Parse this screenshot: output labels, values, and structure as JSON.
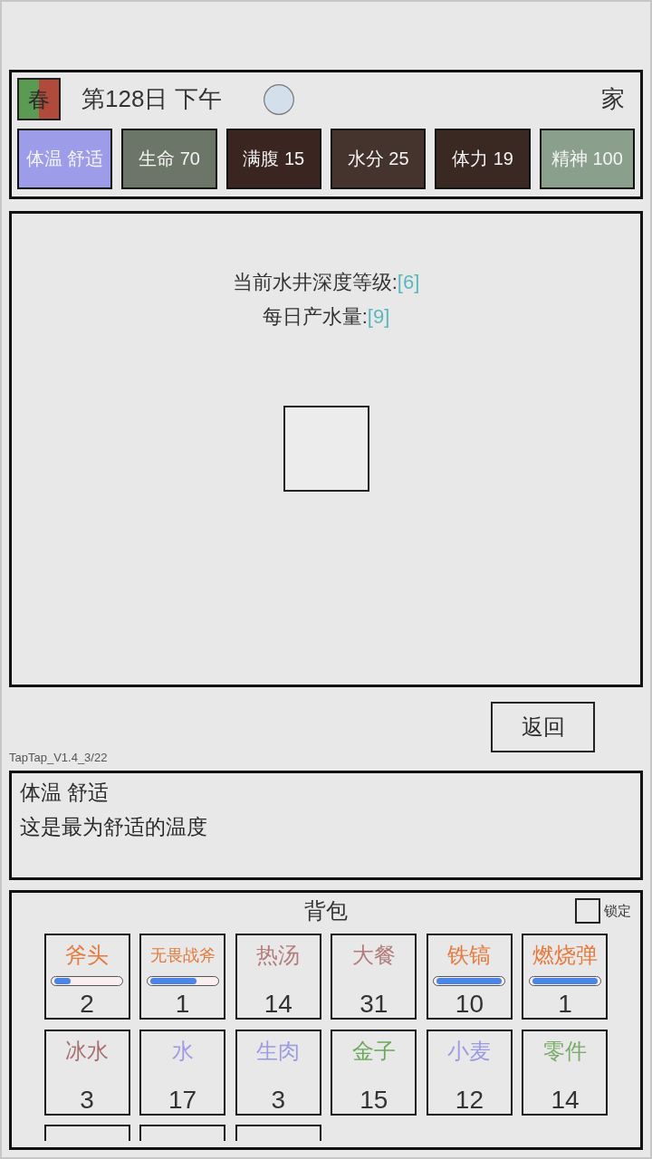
{
  "header": {
    "season": "春",
    "date": "第128日 下午",
    "location": "家"
  },
  "stats": [
    {
      "label": "体温 舒适",
      "color": "#9c9ce8"
    },
    {
      "label": "生命 70",
      "color": "#6c7668"
    },
    {
      "label": "满腹 15",
      "color": "#3a2520"
    },
    {
      "label": "水分 25",
      "color": "#45332d"
    },
    {
      "label": "体力 19",
      "color": "#3a2822"
    },
    {
      "label": "精神 100",
      "color": "#8aa08d"
    }
  ],
  "well": {
    "lines": [
      {
        "text": "当前水井深度等级:",
        "value": "[6]"
      },
      {
        "text": "每日产水量:",
        "value": "[9]"
      }
    ]
  },
  "back_button": "返回",
  "version": "TapTap_V1.4_3/22",
  "info": {
    "title": "体温 舒适",
    "description": "这是最为舒适的温度"
  },
  "inventory": {
    "title": "背包",
    "lock": {
      "label": "锁定",
      "checked": false
    },
    "items": [
      {
        "kind": "tool",
        "name": "斧头",
        "color": "#e5793c",
        "level": 0.25,
        "count": "2"
      },
      {
        "kind": "tool",
        "name": "无畏战斧",
        "color": "#e07a3c",
        "level": 0.72,
        "count": "1"
      },
      {
        "kind": "stack",
        "name": "热汤",
        "color": "#b27c7a",
        "count": "14"
      },
      {
        "kind": "stack",
        "name": "大餐",
        "color": "#b27c7a",
        "count": "31"
      },
      {
        "kind": "tool",
        "name": "铁镐",
        "color": "#e5793c",
        "level": 1,
        "count": "10"
      },
      {
        "kind": "tool",
        "name": "燃烧弹",
        "color": "#e5793c",
        "level": 1,
        "count": "1"
      },
      {
        "kind": "stack",
        "name": "冰水",
        "color": "#a86f6f",
        "count": "3"
      },
      {
        "kind": "stack",
        "name": "水",
        "color": "#9b9be4",
        "count": "17"
      },
      {
        "kind": "stack",
        "name": "生肉",
        "color": "#9b9be4",
        "count": "3"
      },
      {
        "kind": "stack",
        "name": "金子",
        "color": "#6aa85a",
        "count": "15"
      },
      {
        "kind": "stack",
        "name": "小麦",
        "color": "#9b9be4",
        "count": "12"
      },
      {
        "kind": "stack",
        "name": "零件",
        "color": "#78aa68",
        "count": "14"
      },
      {
        "kind": "clipped"
      },
      {
        "kind": "clipped"
      },
      {
        "kind": "clipped"
      }
    ]
  }
}
